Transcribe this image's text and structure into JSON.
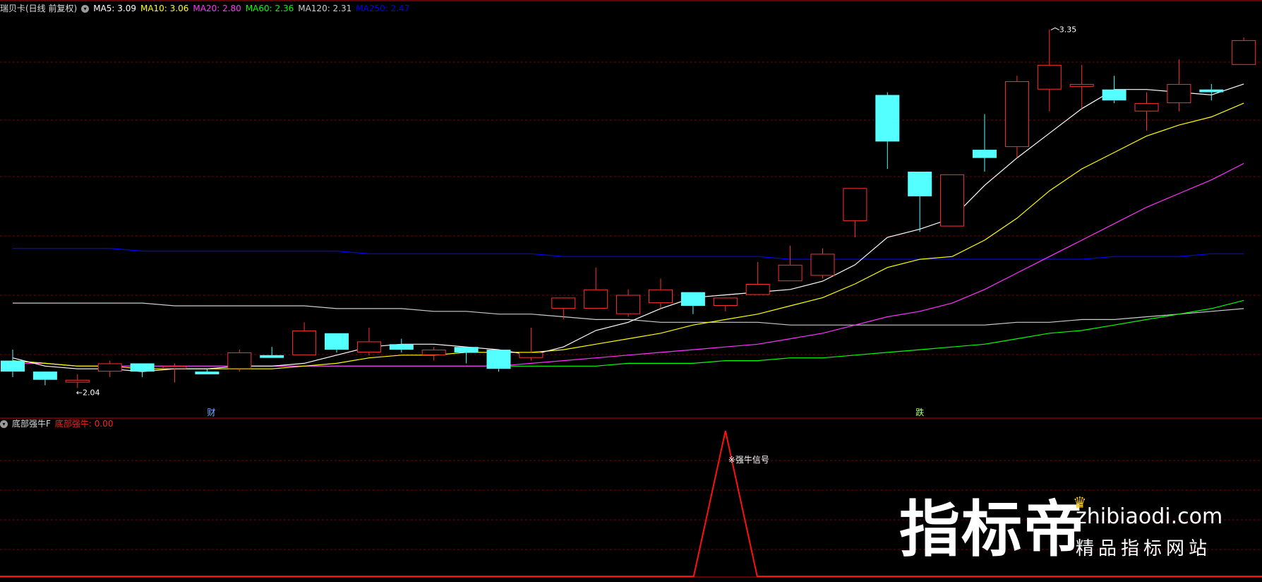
{
  "header": {
    "stock": "瑞贝卡(日线 前复权)",
    "toggle_icon": "chevron-down-icon",
    "ma_labels": [
      {
        "text": "MA5: 3.09",
        "color": "#ffffff"
      },
      {
        "text": "MA10: 3.06",
        "color": "#ffff00"
      },
      {
        "text": "MA20: 2.80",
        "color": "#ff33ff"
      },
      {
        "text": "MA60: 2.36",
        "color": "#00ff00"
      },
      {
        "text": "MA120: 2.31",
        "color": "#cccccc"
      },
      {
        "text": "MA250: 2.47",
        "color": "#0000ff"
      }
    ]
  },
  "sub_header": {
    "indicator": "底部强牛F",
    "value_label": "底部强牛: 0.00",
    "value_color": "#ff2020"
  },
  "markers": {
    "low": "←2.04",
    "high": "3.35",
    "event_cai": "财",
    "event_die": "跌",
    "signal": "※强牛信号"
  },
  "watermark": {
    "cn": "指标帝",
    "url": "zhibiaodi.com",
    "sub": "精品指标网站"
  },
  "colors": {
    "up": "#ff3030",
    "down": "#54ffff",
    "grid": "#7a0000",
    "divider": "#cc0000",
    "signal_line": "#ff1010"
  },
  "chart_data": {
    "type": "candlestick",
    "price_range": [
      1.93,
      3.4
    ],
    "candles": [
      {
        "o": 2.14,
        "h": 2.18,
        "l": 2.08,
        "c": 2.1
      },
      {
        "o": 2.1,
        "h": 2.1,
        "l": 2.05,
        "c": 2.07
      },
      {
        "o": 2.06,
        "h": 2.09,
        "l": 2.04,
        "c": 2.07
      },
      {
        "o": 2.1,
        "h": 2.14,
        "l": 2.08,
        "c": 2.13
      },
      {
        "o": 2.13,
        "h": 2.13,
        "l": 2.08,
        "c": 2.1
      },
      {
        "o": 2.11,
        "h": 2.13,
        "l": 2.06,
        "c": 2.12
      },
      {
        "o": 2.1,
        "h": 2.11,
        "l": 2.09,
        "c": 2.09
      },
      {
        "o": 2.11,
        "h": 2.18,
        "l": 2.1,
        "c": 2.17
      },
      {
        "o": 2.16,
        "h": 2.19,
        "l": 2.15,
        "c": 2.15
      },
      {
        "o": 2.16,
        "h": 2.28,
        "l": 2.16,
        "c": 2.25
      },
      {
        "o": 2.24,
        "h": 2.24,
        "l": 2.17,
        "c": 2.18
      },
      {
        "o": 2.17,
        "h": 2.26,
        "l": 2.16,
        "c": 2.21
      },
      {
        "o": 2.2,
        "h": 2.22,
        "l": 2.17,
        "c": 2.18
      },
      {
        "o": 2.16,
        "h": 2.19,
        "l": 2.14,
        "c": 2.18
      },
      {
        "o": 2.19,
        "h": 2.19,
        "l": 2.13,
        "c": 2.17
      },
      {
        "o": 2.18,
        "h": 2.18,
        "l": 2.1,
        "c": 2.11
      },
      {
        "o": 2.15,
        "h": 2.26,
        "l": 2.14,
        "c": 2.17
      },
      {
        "o": 2.33,
        "h": 2.33,
        "l": 2.29,
        "c": 2.37
      },
      {
        "o": 2.33,
        "h": 2.48,
        "l": 2.33,
        "c": 2.4
      },
      {
        "o": 2.31,
        "h": 2.4,
        "l": 2.3,
        "c": 2.38
      },
      {
        "o": 2.35,
        "h": 2.44,
        "l": 2.33,
        "c": 2.4
      },
      {
        "o": 2.39,
        "h": 2.39,
        "l": 2.31,
        "c": 2.34
      },
      {
        "o": 2.34,
        "h": 2.37,
        "l": 2.32,
        "c": 2.37
      },
      {
        "o": 2.38,
        "h": 2.5,
        "l": 2.38,
        "c": 2.42
      },
      {
        "o": 2.43,
        "h": 2.56,
        "l": 2.43,
        "c": 2.49
      },
      {
        "o": 2.45,
        "h": 2.55,
        "l": 2.44,
        "c": 2.53
      },
      {
        "o": 2.65,
        "h": 2.67,
        "l": 2.59,
        "c": 2.77
      },
      {
        "o": 3.11,
        "h": 3.12,
        "l": 2.84,
        "c": 2.94
      },
      {
        "o": 2.83,
        "h": 2.83,
        "l": 2.61,
        "c": 2.74
      },
      {
        "o": 2.63,
        "h": 2.79,
        "l": 2.63,
        "c": 2.82
      },
      {
        "o": 2.91,
        "h": 3.04,
        "l": 2.83,
        "c": 2.88
      },
      {
        "o": 2.92,
        "h": 3.18,
        "l": 2.88,
        "c": 3.16
      },
      {
        "o": 3.13,
        "h": 3.35,
        "l": 3.05,
        "c": 3.22
      },
      {
        "o": 3.14,
        "h": 3.22,
        "l": 3.06,
        "c": 3.15
      },
      {
        "o": 3.13,
        "h": 3.18,
        "l": 3.08,
        "c": 3.09
      },
      {
        "o": 3.05,
        "h": 3.12,
        "l": 2.98,
        "c": 3.08
      },
      {
        "o": 3.08,
        "h": 3.24,
        "l": 3.05,
        "c": 3.15
      },
      {
        "o": 3.13,
        "h": 3.15,
        "l": 3.09,
        "c": 3.12
      },
      {
        "o": 3.22,
        "h": 3.32,
        "l": 3.22,
        "c": 3.31
      }
    ],
    "ma5": [
      2.15,
      2.12,
      2.11,
      2.11,
      2.1,
      2.11,
      2.11,
      2.12,
      2.12,
      2.13,
      2.16,
      2.19,
      2.2,
      2.2,
      2.19,
      2.18,
      2.16,
      2.19,
      2.25,
      2.28,
      2.33,
      2.37,
      2.38,
      2.39,
      2.4,
      2.43,
      2.49,
      2.59,
      2.62,
      2.66,
      2.78,
      2.88,
      2.97,
      3.06,
      3.13,
      3.13,
      3.12,
      3.11,
      3.15
    ],
    "ma10": [
      2.14,
      2.13,
      2.12,
      2.12,
      2.11,
      2.11,
      2.11,
      2.11,
      2.11,
      2.12,
      2.13,
      2.15,
      2.16,
      2.16,
      2.17,
      2.17,
      2.17,
      2.18,
      2.2,
      2.22,
      2.24,
      2.27,
      2.29,
      2.31,
      2.34,
      2.37,
      2.42,
      2.48,
      2.51,
      2.52,
      2.58,
      2.66,
      2.76,
      2.84,
      2.9,
      2.96,
      3.0,
      3.03,
      3.08
    ],
    "ma20": [
      2.13,
      2.13,
      2.12,
      2.12,
      2.12,
      2.12,
      2.12,
      2.12,
      2.12,
      2.12,
      2.12,
      2.12,
      2.12,
      2.12,
      2.12,
      2.12,
      2.13,
      2.14,
      2.15,
      2.16,
      2.17,
      2.18,
      2.19,
      2.2,
      2.22,
      2.24,
      2.27,
      2.3,
      2.32,
      2.35,
      2.4,
      2.46,
      2.52,
      2.58,
      2.64,
      2.7,
      2.75,
      2.8,
      2.86
    ],
    "ma60": [
      2.14,
      2.13,
      2.12,
      2.12,
      2.12,
      2.12,
      2.12,
      2.12,
      2.12,
      2.12,
      2.12,
      2.12,
      2.12,
      2.12,
      2.12,
      2.12,
      2.12,
      2.12,
      2.12,
      2.13,
      2.13,
      2.13,
      2.14,
      2.14,
      2.15,
      2.15,
      2.16,
      2.17,
      2.18,
      2.19,
      2.2,
      2.22,
      2.24,
      2.25,
      2.27,
      2.29,
      2.31,
      2.33,
      2.36
    ],
    "ma120": [
      2.35,
      2.35,
      2.35,
      2.35,
      2.35,
      2.34,
      2.34,
      2.34,
      2.34,
      2.34,
      2.33,
      2.33,
      2.33,
      2.32,
      2.32,
      2.31,
      2.31,
      2.3,
      2.29,
      2.29,
      2.28,
      2.28,
      2.28,
      2.28,
      2.27,
      2.27,
      2.27,
      2.27,
      2.27,
      2.27,
      2.27,
      2.28,
      2.28,
      2.29,
      2.29,
      2.3,
      2.31,
      2.32,
      2.33
    ],
    "ma250": [
      2.55,
      2.55,
      2.55,
      2.55,
      2.54,
      2.54,
      2.54,
      2.54,
      2.54,
      2.54,
      2.54,
      2.53,
      2.53,
      2.53,
      2.53,
      2.53,
      2.53,
      2.52,
      2.52,
      2.52,
      2.52,
      2.52,
      2.52,
      2.52,
      2.51,
      2.51,
      2.51,
      2.51,
      2.51,
      2.51,
      2.51,
      2.51,
      2.51,
      2.51,
      2.52,
      2.52,
      2.52,
      2.53,
      2.53
    ],
    "signal": {
      "name": "底部强牛",
      "values": [
        0,
        0,
        0,
        0,
        0,
        0,
        0,
        0,
        0,
        0,
        0,
        0,
        0,
        0,
        0,
        0,
        0,
        0,
        0,
        0,
        0,
        0,
        1,
        0,
        0,
        0,
        0,
        0,
        0,
        0,
        0,
        0,
        0,
        0,
        0,
        0,
        0,
        0,
        0
      ]
    }
  }
}
